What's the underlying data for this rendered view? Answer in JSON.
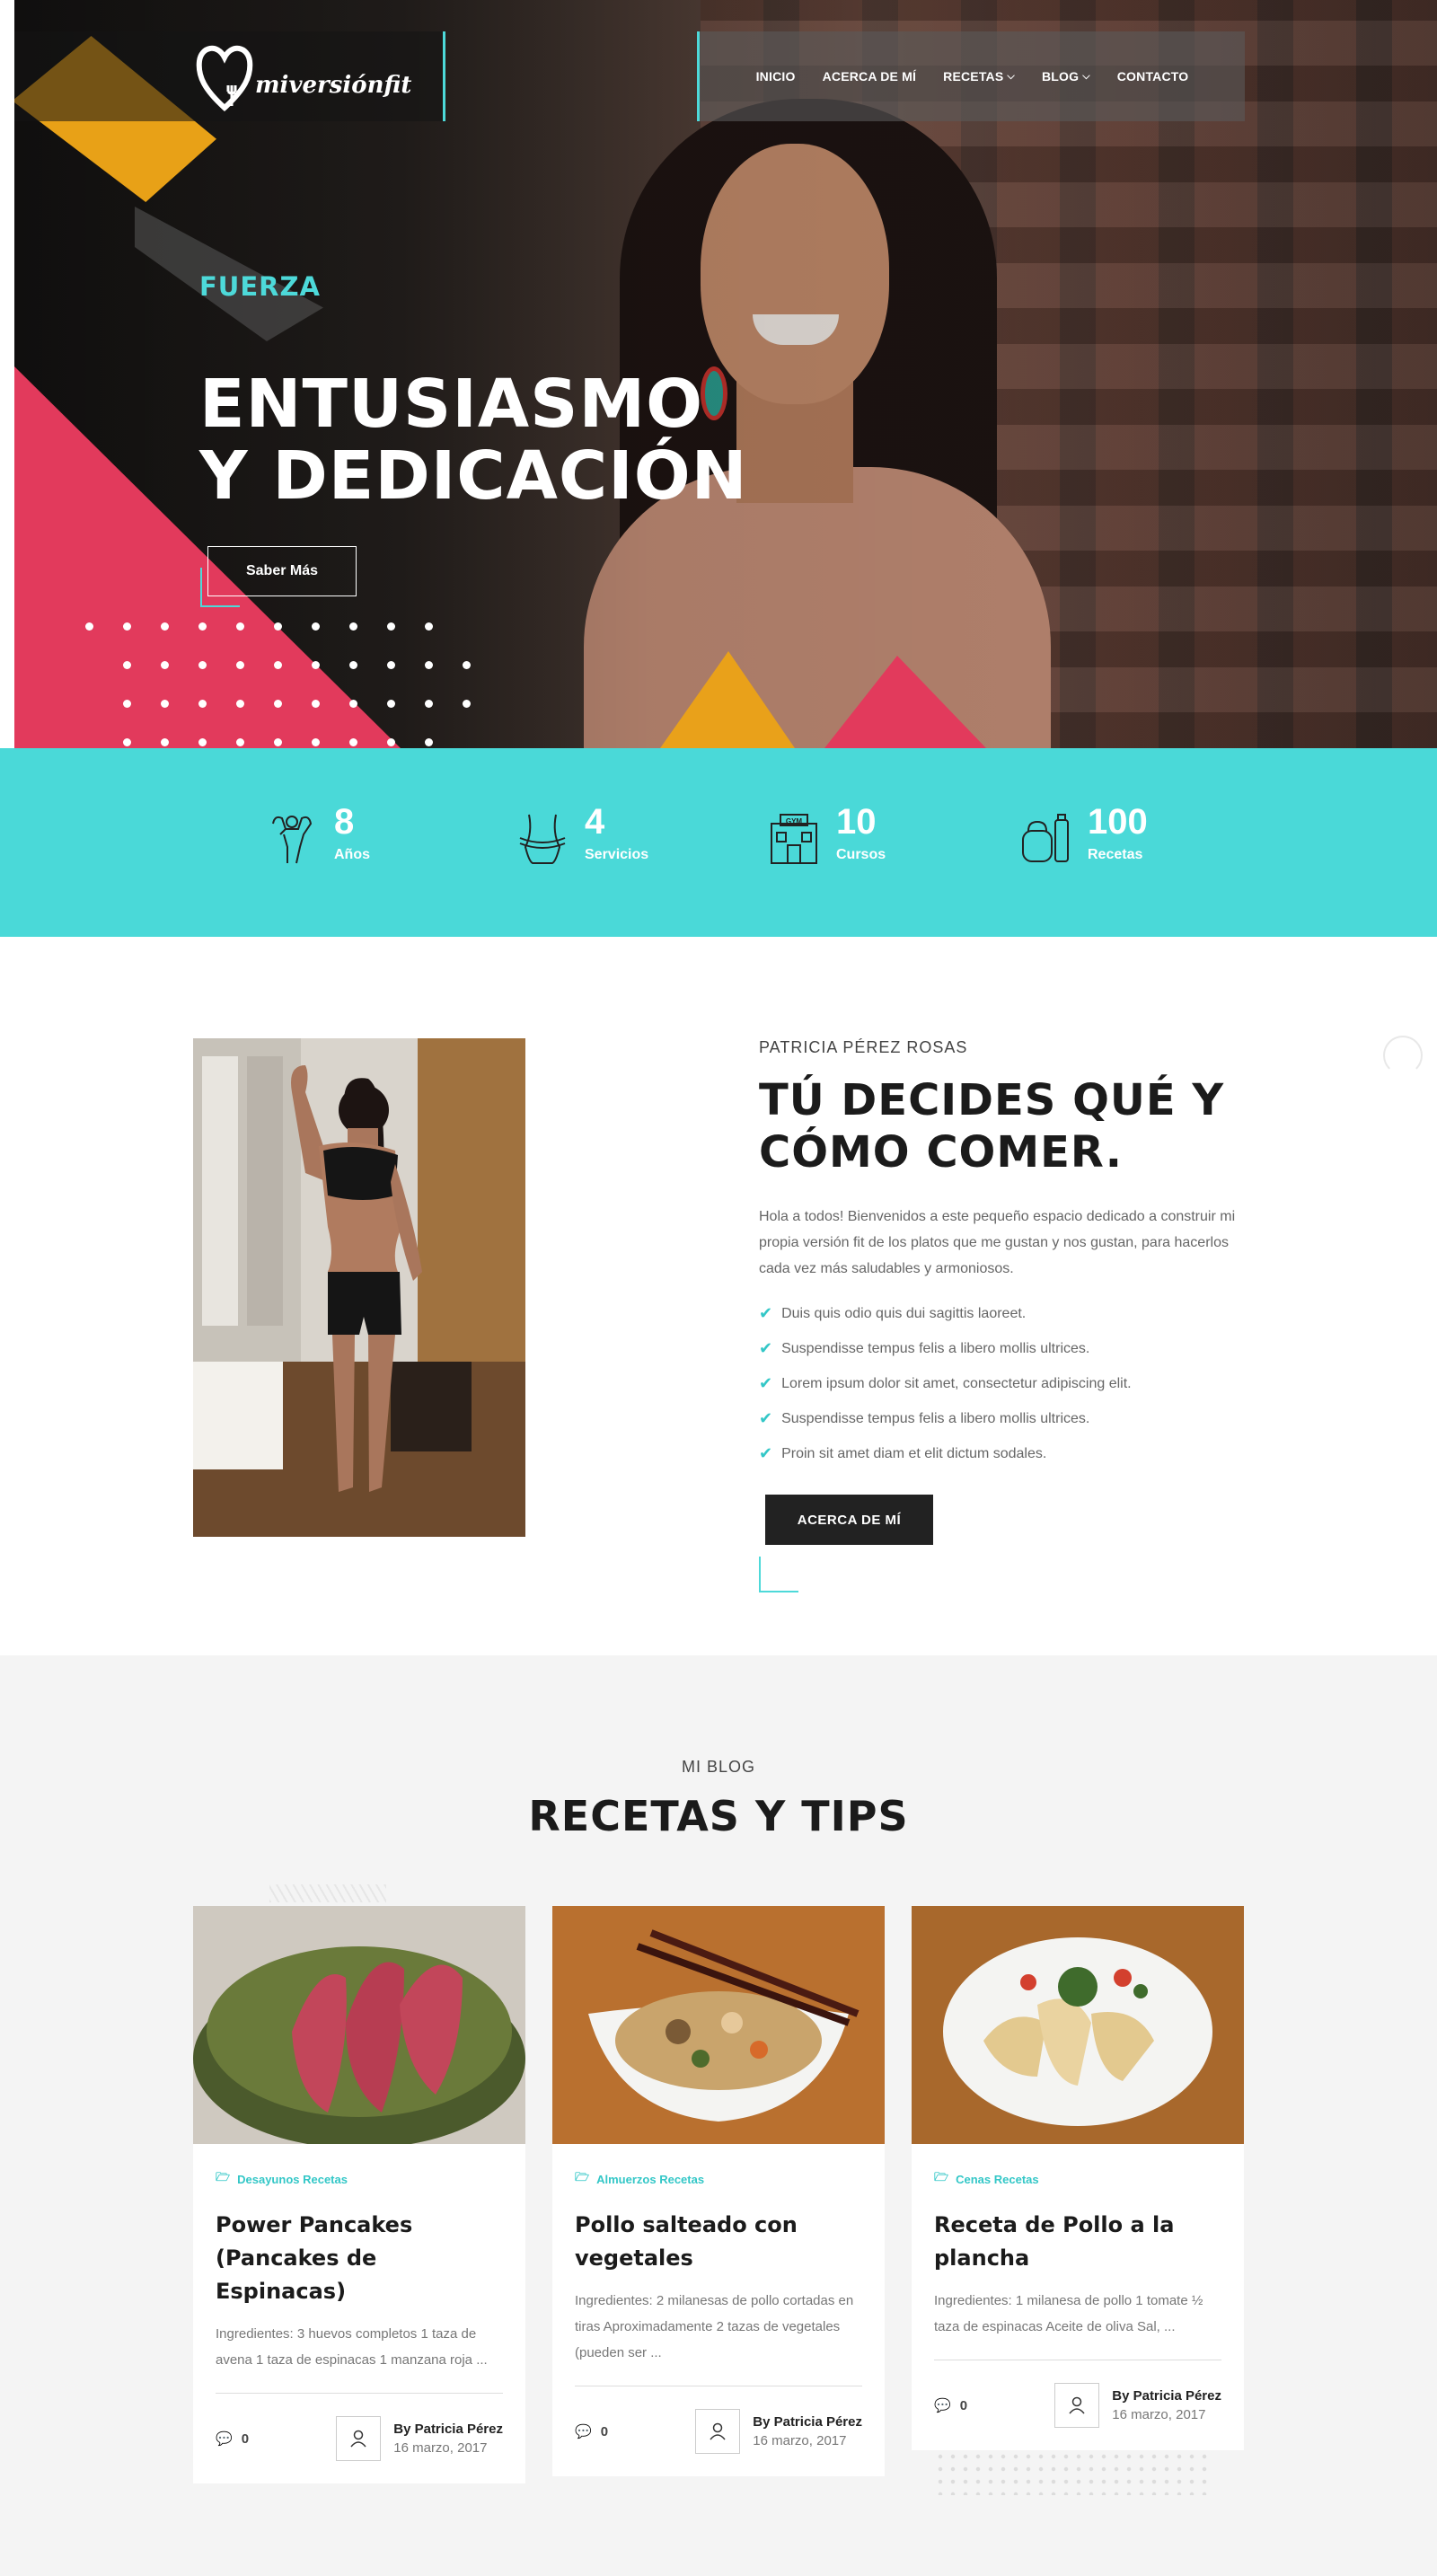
{
  "header": {
    "logo_text": "miversiónfit",
    "nav": [
      {
        "label": "INICIO",
        "has_dropdown": false
      },
      {
        "label": "ACERCA DE MÍ",
        "has_dropdown": false
      },
      {
        "label": "RECETAS",
        "has_dropdown": true
      },
      {
        "label": "BLOG",
        "has_dropdown": true
      },
      {
        "label": "CONTACTO",
        "has_dropdown": false
      }
    ]
  },
  "hero": {
    "subtitle": "FUERZA",
    "title_line1": "ENTUSIASMO",
    "title_line2": "Y DEDICACIÓN",
    "button_label": "Saber Más"
  },
  "stats": [
    {
      "icon": "muscle-man-icon",
      "number": "8",
      "label": "Años"
    },
    {
      "icon": "waist-measure-icon",
      "number": "4",
      "label": "Servicios"
    },
    {
      "icon": "gym-building-icon",
      "number": "10",
      "label": "Cursos"
    },
    {
      "icon": "kettlebell-bottle-icon",
      "number": "100",
      "label": "Recetas"
    }
  ],
  "about": {
    "eyebrow": "PATRICIA PÉREZ ROSAS",
    "title_line1": "TÚ DECIDES QUÉ Y",
    "title_line2": "CÓMO COMER.",
    "text": "Hola a todos! Bienvenidos a este pequeño espacio dedicado a construir mi propia versión fit de los platos que me gustan y nos gustan, para hacerlos cada vez más saludables y armoniosos.",
    "list": [
      "Duis quis odio quis dui sagittis laoreet.",
      "Suspendisse tempus felis a libero mollis ultrices.",
      "Lorem ipsum dolor sit amet, consectetur adipiscing elit.",
      "Suspendisse tempus felis a libero mollis ultrices.",
      "Proin sit amet diam et elit dictum sodales."
    ],
    "button_label": "ACERCA DE MÍ"
  },
  "blog": {
    "eyebrow": "MI BLOG",
    "title": "RECETAS Y TIPS",
    "posts": [
      {
        "category": "Desayunos Recetas",
        "title": "Power Pancakes (Pancakes de Espinacas)",
        "excerpt": "Ingredientes: 3 huevos completos 1 taza de avena 1 taza de espinacas 1 manzana roja ...",
        "comments": "0",
        "author": "By Patricia Pérez",
        "date": "16 marzo, 2017"
      },
      {
        "category": "Almuerzos Recetas",
        "title": "Pollo salteado con vegetales",
        "excerpt": "Ingredientes: 2 milanesas de pollo cortadas en tiras Aproximadamente 2 tazas de vegetales (pueden ser ...",
        "comments": "0",
        "author": "By Patricia Pérez",
        "date": "16 marzo, 2017"
      },
      {
        "category": "Cenas Recetas",
        "title": "Receta de Pollo a la plancha",
        "excerpt": "Ingredientes: 1 milanesa de pollo 1 tomate ½ taza de espinacas Aceite de oliva Sal, ...",
        "comments": "0",
        "author": "By Patricia Pérez",
        "date": "16 marzo, 2017"
      }
    ]
  },
  "colors": {
    "accent_teal": "#4ad9d8",
    "accent_pink": "#e23a5c",
    "accent_yellow": "#e8a117",
    "dark": "#222222"
  }
}
